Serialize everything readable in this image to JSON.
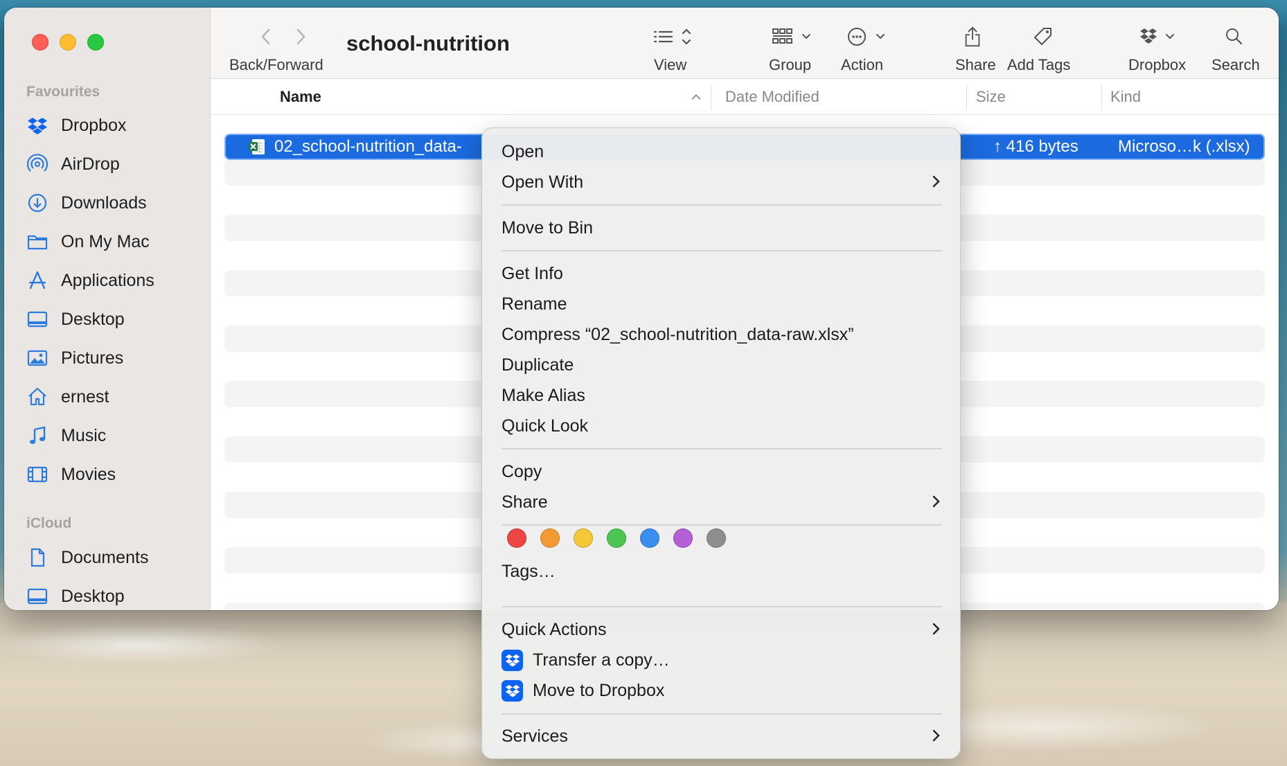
{
  "window": {
    "title": "school-nutrition"
  },
  "toolbar": {
    "back_forward": "Back/Forward",
    "view": "View",
    "group": "Group",
    "action": "Action",
    "share": "Share",
    "add_tags": "Add Tags",
    "dropbox": "Dropbox",
    "search": "Search"
  },
  "sidebar": {
    "favourites_heading": "Favourites",
    "favourites": [
      {
        "label": "Dropbox",
        "icon": "dropbox-icon"
      },
      {
        "label": "AirDrop",
        "icon": "airdrop-icon"
      },
      {
        "label": "Downloads",
        "icon": "downloads-icon"
      },
      {
        "label": "On My Mac",
        "icon": "folder-icon"
      },
      {
        "label": "Applications",
        "icon": "applications-icon"
      },
      {
        "label": "Desktop",
        "icon": "desktop-icon"
      },
      {
        "label": "Pictures",
        "icon": "pictures-icon"
      },
      {
        "label": "ernest",
        "icon": "home-icon"
      },
      {
        "label": "Music",
        "icon": "music-icon"
      },
      {
        "label": "Movies",
        "icon": "movies-icon"
      }
    ],
    "icloud_heading": "iCloud",
    "icloud": [
      {
        "label": "Documents",
        "icon": "document-icon"
      },
      {
        "label": "Desktop",
        "icon": "desktop-icon"
      }
    ]
  },
  "columns": {
    "name": "Name",
    "date_modified": "Date Modified",
    "size": "Size",
    "kind": "Kind"
  },
  "file": {
    "name_visible": "02_school-nutrition_data-",
    "size": "↑ 416 bytes",
    "kind": "Microso…k (.xlsx)"
  },
  "context_menu": {
    "open": "Open",
    "open_with": "Open With",
    "move_to_bin": "Move to Bin",
    "get_info": "Get Info",
    "rename": "Rename",
    "compress": "Compress “02_school-nutrition_data-raw.xlsx”",
    "duplicate": "Duplicate",
    "make_alias": "Make Alias",
    "quick_look": "Quick Look",
    "copy": "Copy",
    "share": "Share",
    "tags": "Tags…",
    "quick_actions": "Quick Actions",
    "transfer_copy": "Transfer a copy…",
    "move_to_dropbox": "Move to Dropbox",
    "services": "Services",
    "tag_colors": [
      "#ee4545",
      "#f59a33",
      "#f6c738",
      "#4cc552",
      "#3c8df0",
      "#b35fd6",
      "#8e8e8e"
    ]
  }
}
